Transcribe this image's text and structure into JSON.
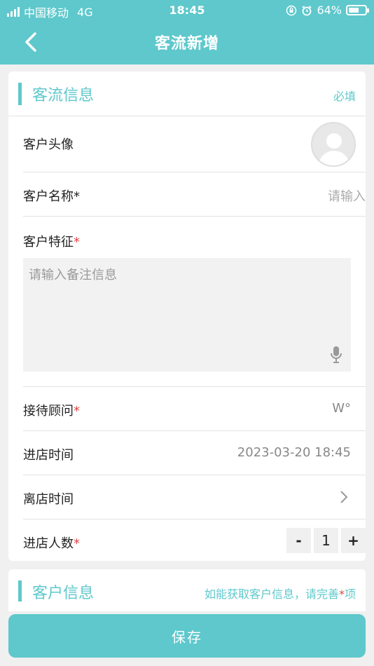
{
  "status_bar": {
    "carrier": "中国移动",
    "network": "4G",
    "time": "18:45",
    "battery": "64%",
    "battery_level": 0.64
  },
  "nav": {
    "title": "客流新增"
  },
  "flow_section": {
    "title": "客流信息",
    "tip": "必填",
    "rows": {
      "avatar": {
        "label": "客户头像"
      },
      "name": {
        "label": "客户名称*",
        "placeholder": "请输入"
      },
      "feature": {
        "label": "客户特征",
        "required_mark": "*",
        "placeholder": "请输入备注信息"
      },
      "advisor": {
        "label": "接待顾问",
        "required_mark": "*",
        "value": "W°"
      },
      "arrive": {
        "label": "进店时间",
        "value": "2023-03-20 18:45"
      },
      "leave": {
        "label": "离店时间"
      },
      "count": {
        "label": "进店人数",
        "required_mark": "*",
        "minus": "-",
        "value": "1",
        "plus": "+"
      }
    }
  },
  "customer_section": {
    "title": "客户信息",
    "tip_pre": "如能获取客户信息，请完善",
    "tip_mark": "*",
    "tip_post": "项"
  },
  "save_label": "保存",
  "colors": {
    "accent": "#5ec8cc",
    "required": "#e04545"
  }
}
